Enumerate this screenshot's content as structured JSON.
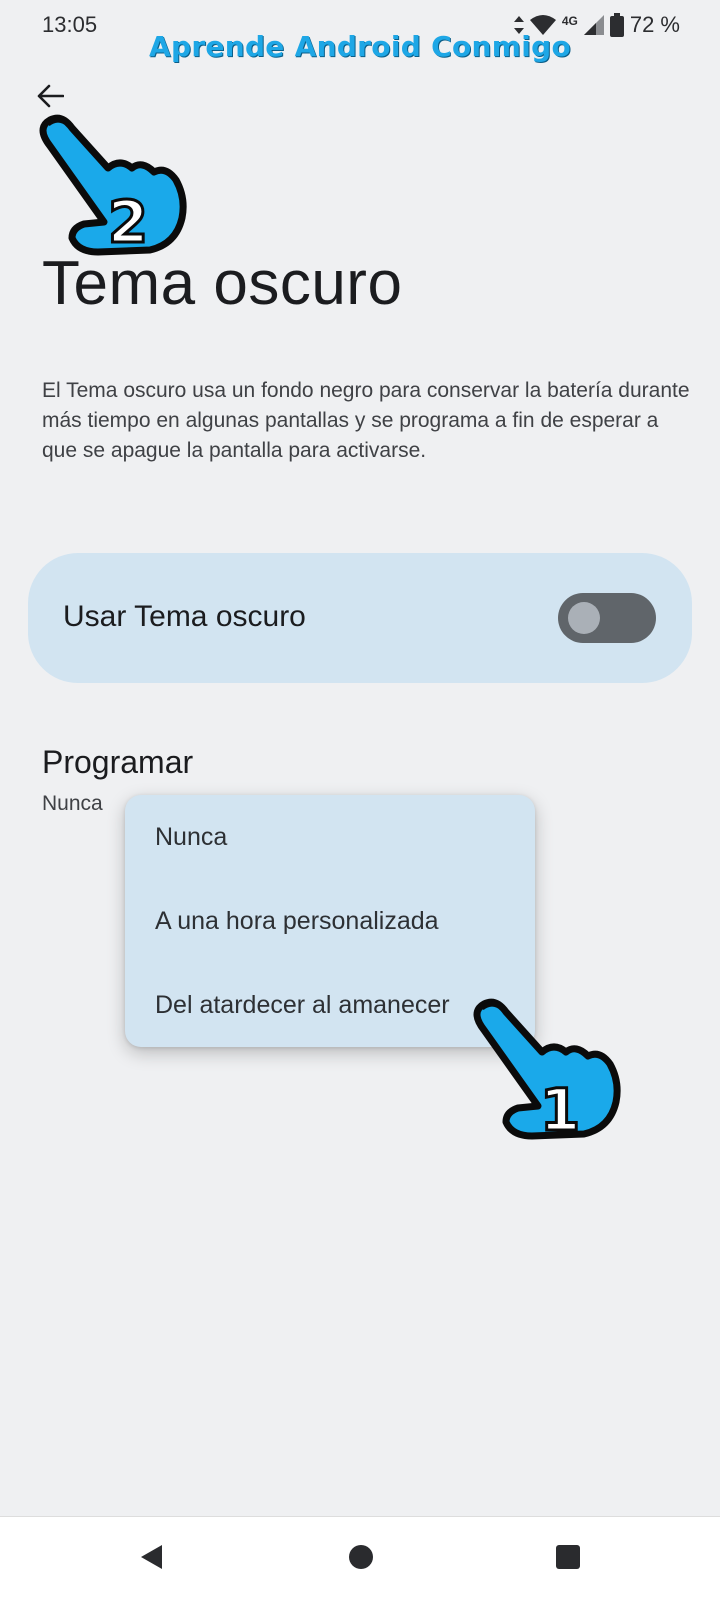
{
  "status_bar": {
    "time": "13:05",
    "network": "4G",
    "battery": "72 %",
    "icons": [
      "data-arrows-icon",
      "wifi-icon",
      "signal-icon",
      "battery-icon"
    ]
  },
  "watermark": "Aprende Android Conmigo",
  "header": {
    "back_icon": "back-arrow-icon",
    "title": "Tema oscuro"
  },
  "description": "El Tema oscuro usa un fondo negro para conservar la batería durante más tiempo en algunas pantallas y se programa a fin de esperar a que se apague la pantalla para activarse.",
  "dark_theme_toggle": {
    "label": "Usar Tema oscuro",
    "checked": false
  },
  "schedule": {
    "title": "Programar",
    "value": "Nunca"
  },
  "schedule_menu": {
    "options": [
      "Nunca",
      "A una hora personalizada",
      "Del atardecer al amanecer"
    ]
  },
  "annotations": [
    {
      "icon": "pointing-hand-icon",
      "step": "2"
    },
    {
      "icon": "pointing-hand-icon",
      "step": "1"
    }
  ],
  "colors": {
    "background": "#eff0f2",
    "card": "#d2e4f1",
    "accent": "#1ea7e6"
  },
  "nav_bar": {
    "icons": [
      "back-triangle-icon",
      "home-circle-icon",
      "recents-square-icon"
    ]
  }
}
